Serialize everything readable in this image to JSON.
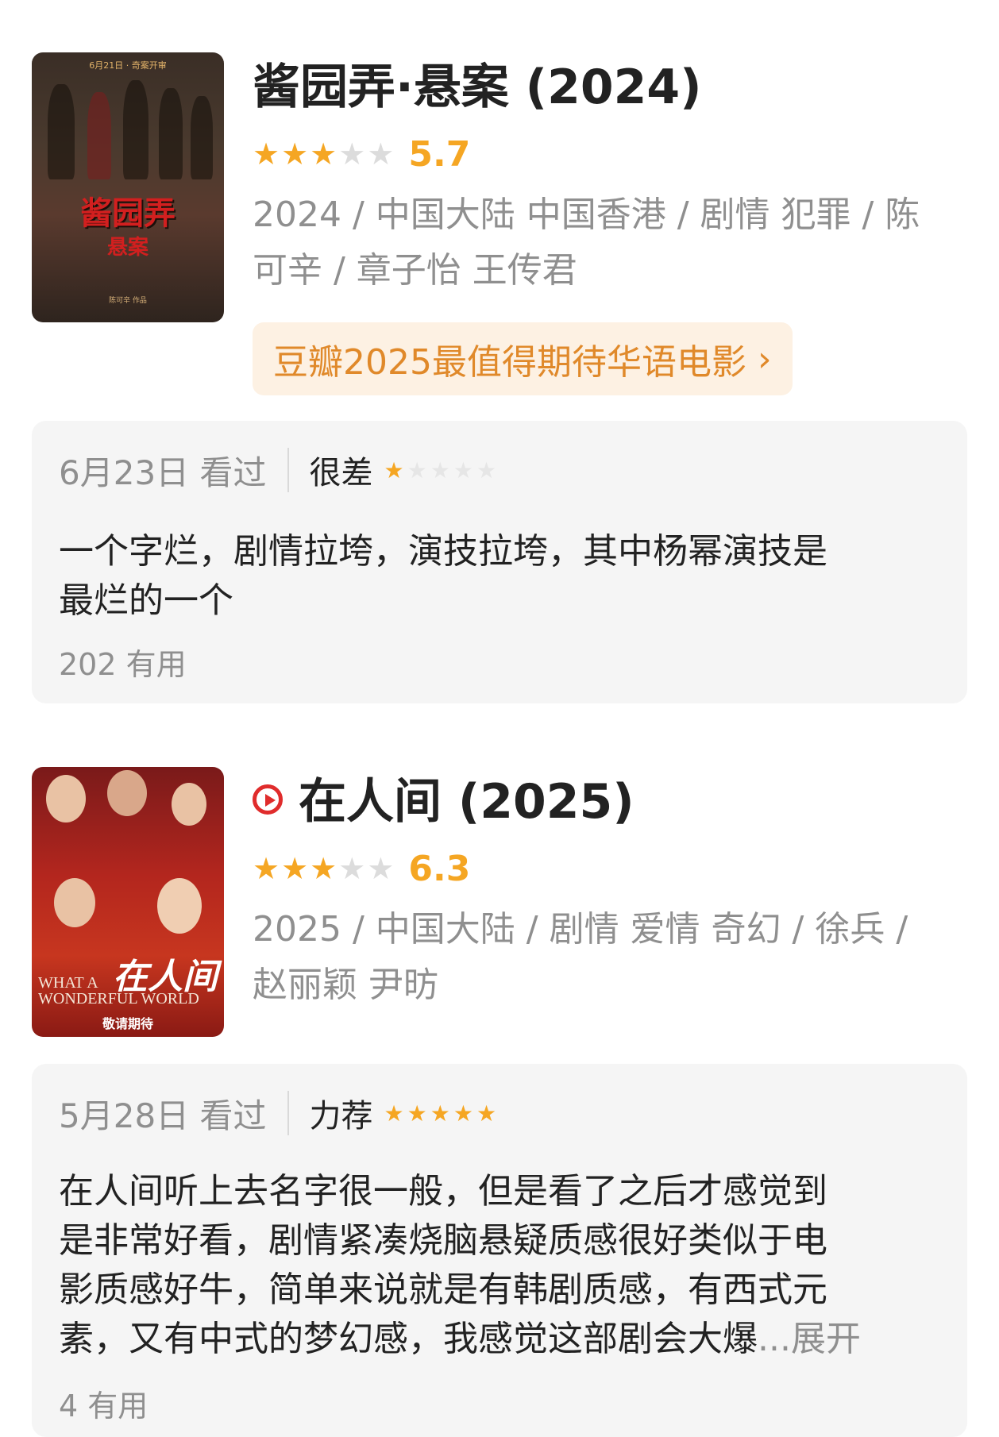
{
  "movies": [
    {
      "title": "酱园弄·悬案 (2024)",
      "stars": {
        "filled": 3,
        "total": 5
      },
      "score": "5.7",
      "meta_line1": "2024 / 中国大陆 中国香港 / 剧情 犯罪 / 陈",
      "meta_line2": "可辛 / 章子怡 王传君",
      "promo": "豆瓣2025最值得期待华语电影",
      "poster": {
        "tag": "6月21日 · 奇案开审",
        "art_title": "酱园弄",
        "art_sub": "悬案",
        "foot": "陈可辛 作品"
      },
      "review": {
        "date": "6月23日 看过",
        "label": "很差",
        "stars": {
          "filled": 1,
          "total": 5
        },
        "text_line1": "一个字烂，剧情拉垮，演技拉垮，其中杨幂演技是",
        "text_line2": "最烂的一个",
        "useful": "202 有用"
      }
    },
    {
      "title": "在人间 (2025)",
      "stars": {
        "filled": 3,
        "total": 5
      },
      "score": "6.3",
      "meta_line1": "2025 / 中国大陆 / 剧情 爱情 奇幻 / 徐兵 /",
      "meta_line2": "赵丽颖 尹昉",
      "poster": {
        "art_title": "在人间",
        "en_line1": "WHAT A",
        "en_line2": "WONDERFUL WORLD",
        "foot": "敬请期待"
      },
      "review": {
        "date": "5月28日 看过",
        "label": "力荐",
        "stars": {
          "filled": 5,
          "total": 5
        },
        "text_line1": "在人间听上去名字很一般，但是看了之后才感觉到",
        "text_line2": "是非常好看，剧情紧凑烧脑悬疑质感很好类似于电",
        "text_line3": "影质感好牛，简单来说就是有韩剧质感，有西式元",
        "text_line4": "素，又有中式的梦幻感，我感觉这部剧会大爆",
        "more": "...展开",
        "useful": "4 有用"
      }
    }
  ],
  "colors": {
    "star": "#f5a623",
    "promo_bg": "#fdf1e3",
    "promo_text": "#e0892a",
    "play_icon": "#e02c2c",
    "card_bg": "#f5f5f5"
  },
  "icons": [
    "star-icon",
    "play-icon",
    "chevron-right-icon"
  ]
}
